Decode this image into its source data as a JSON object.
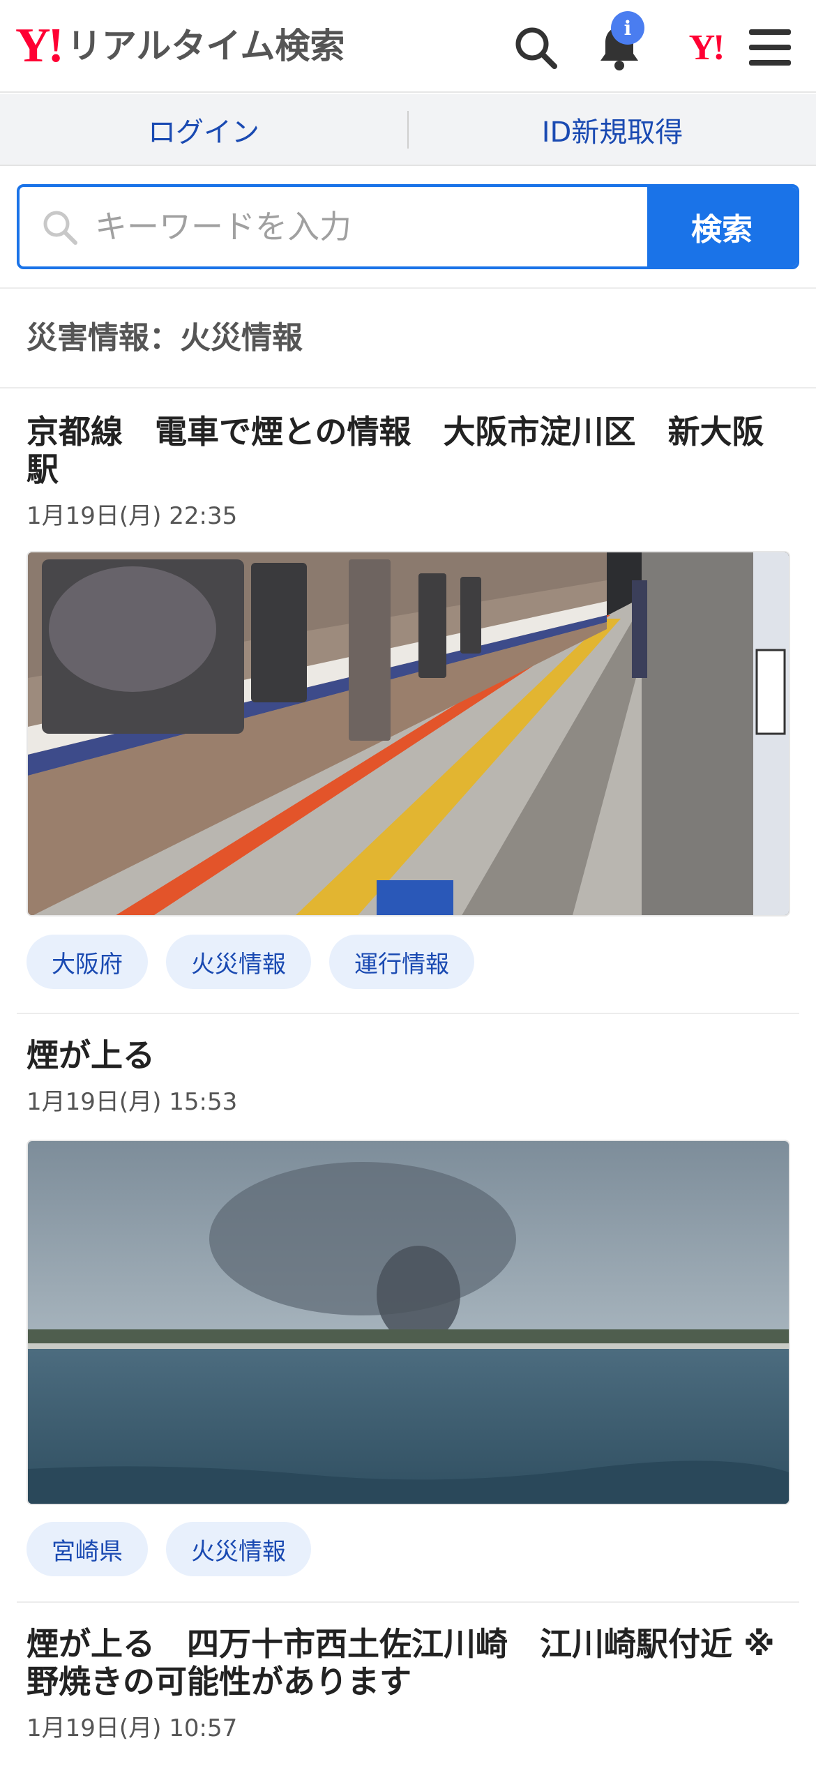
{
  "header": {
    "logo_mark": "Y!",
    "title": "リアルタイム検索",
    "notification_badge": "i",
    "yahoo_mini": "Y!"
  },
  "auth": {
    "login_label": "ログイン",
    "register_label": "ID新規取得"
  },
  "search": {
    "placeholder": "キーワードを入力",
    "button_label": "検索"
  },
  "section": {
    "title": "災害情報：火災情報"
  },
  "articles": [
    {
      "title": "京都線　電車で煙との情報　大阪市淀川区　新大阪駅",
      "time": "1月19日(月) 22:35",
      "tags": [
        "大阪府",
        "火災情報",
        "運行情報"
      ]
    },
    {
      "title": "煙が上る",
      "time": "1月19日(月) 15:53",
      "tags": [
        "宮崎県",
        "火災情報"
      ]
    },
    {
      "title": "煙が上る　四万十市西土佐江川崎　江川崎駅付近 ※野焼きの可能性があります",
      "time": "1月19日(月) 10:57",
      "tags": []
    }
  ],
  "colors": {
    "brand_red": "#ff0033",
    "accent_blue": "#1a73e8",
    "link_blue": "#1a4ab2",
    "tag_bg": "#e8f0fc"
  }
}
